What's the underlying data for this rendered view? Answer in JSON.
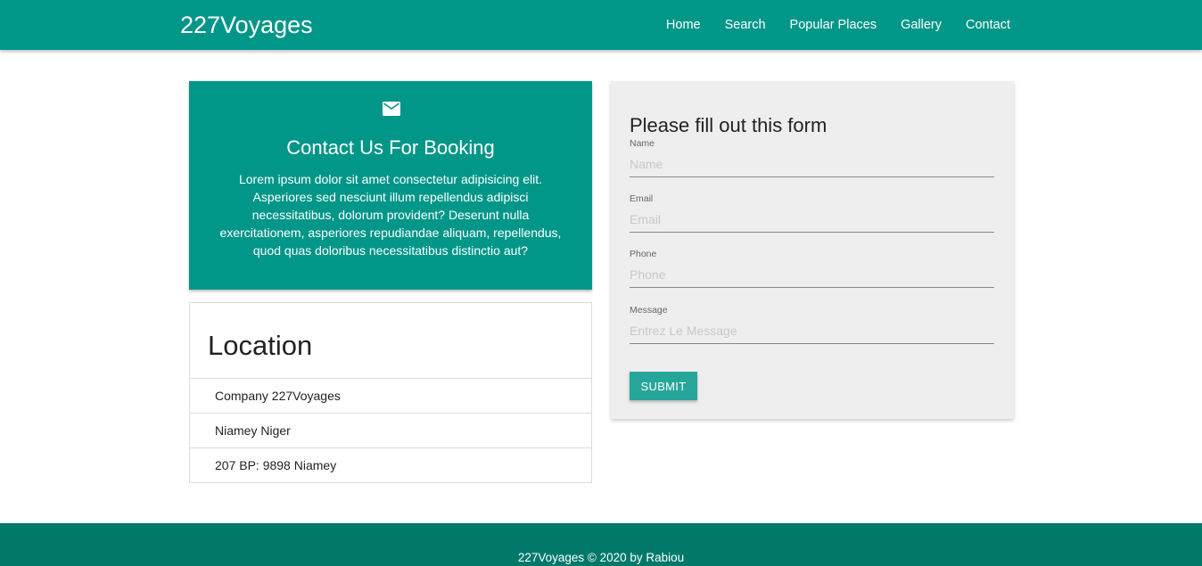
{
  "nav": {
    "brand": "227Voyages",
    "links": [
      "Home",
      "Search",
      "Popular Places",
      "Gallery",
      "Contact"
    ],
    "color": "#009688"
  },
  "booking": {
    "icon": "mail-icon",
    "title": "Contact Us For Booking",
    "text": "Lorem ipsum dolor sit amet consectetur adipisicing elit. Asperiores sed nesciunt illum repellendus adipisci necessitatibus, dolorum provident? Deserunt nulla exercitationem, asperiores repudiandae aliquam, repellendus, quod quas doloribus necessitatibus distinctio aut?"
  },
  "location": {
    "title": "Location",
    "items": [
      "Company 227Voyages",
      "Niamey Niger",
      "207 BP: 9898 Niamey"
    ]
  },
  "form": {
    "title": "Please fill out this form",
    "fields": [
      {
        "label": "Name",
        "placeholder": "Name",
        "value": ""
      },
      {
        "label": "Email",
        "placeholder": "Email",
        "value": ""
      },
      {
        "label": "Phone",
        "placeholder": "Phone",
        "value": ""
      },
      {
        "label": "Message",
        "placeholder": "Entrez Le Message",
        "value": ""
      }
    ],
    "submit_label": "SUBMIT",
    "button_color": "#26a69a"
  },
  "footer": {
    "text": "227Voyages © 2020 by Rabiou",
    "color": "#00796b"
  }
}
